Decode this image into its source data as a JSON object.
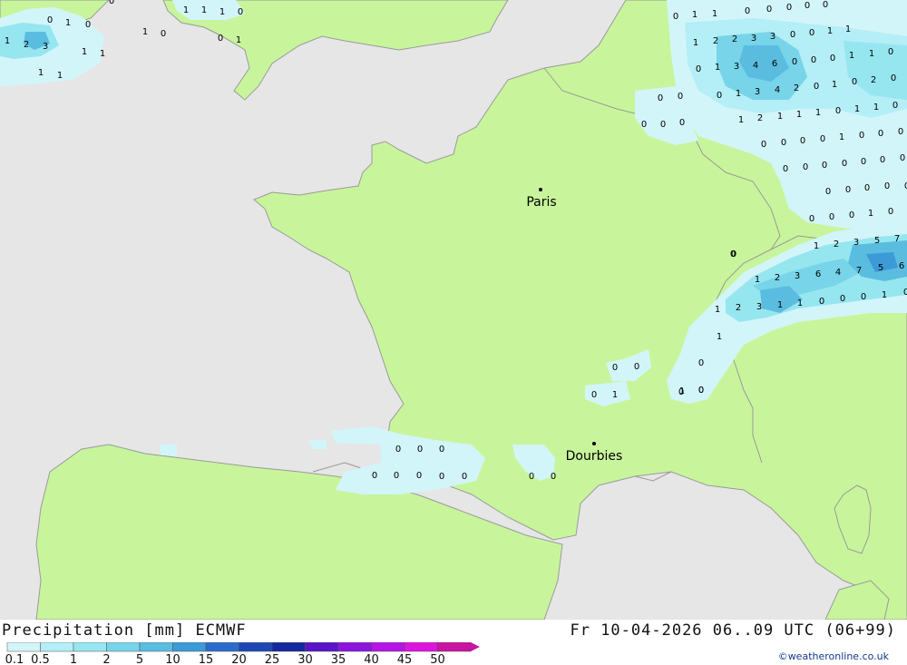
{
  "map": {
    "cities": [
      {
        "name": "Paris"
      },
      {
        "name": "Dourbies"
      }
    ],
    "precip_values_note": "Numbers are precipitation amounts (mm) printed on the map grid",
    "values": {
      "uk": [
        "0",
        "1",
        "0",
        "1",
        "1",
        "1",
        "0",
        "1",
        "0",
        "0",
        "1",
        "1",
        "2",
        "3",
        "1",
        "1",
        "1",
        "1",
        "0"
      ],
      "benelux": [
        "0",
        "1",
        "1",
        "0",
        "0",
        "0",
        "0",
        "0",
        "1",
        "2",
        "2",
        "3",
        "3",
        "0",
        "0",
        "1",
        "1",
        "0",
        "1",
        "3",
        "4",
        "6",
        "0",
        "0",
        "0",
        "1",
        "1",
        "0",
        "0",
        "1",
        "3",
        "4",
        "2",
        "0",
        "1",
        "0",
        "2",
        "0",
        "0",
        "0",
        "1",
        "2",
        "1",
        "1",
        "1",
        "0",
        "1",
        "1",
        "0",
        "0",
        "0",
        "0",
        "0",
        "0",
        "0",
        "0",
        "1",
        "0",
        "0",
        "0",
        "0",
        "0",
        "0",
        "0",
        "0",
        "0",
        "0",
        "0",
        "0",
        "0",
        "0",
        "0",
        "0",
        "0",
        "1",
        "0",
        "0",
        "0",
        "0"
      ],
      "alps": [
        "1",
        "2",
        "3",
        "5",
        "7",
        "1",
        "2",
        "3",
        "6",
        "4",
        "7",
        "5",
        "6",
        "1",
        "2",
        "3",
        "1",
        "1",
        "0",
        "0",
        "0",
        "1",
        "0",
        "0",
        "1",
        "0",
        "0"
      ],
      "central": [
        "0",
        "0",
        "0",
        "1",
        "1",
        "0"
      ],
      "southwest": [
        "0",
        "0",
        "0",
        "0",
        "0",
        "0",
        "0",
        "0",
        "0",
        "0"
      ]
    }
  },
  "footer": {
    "title": "Precipitation [mm] ECMWF",
    "datetime": "Fr 10-04-2026 06..09 UTC (06+99)",
    "credit": "©weatheronline.co.uk"
  },
  "legend": {
    "labels": [
      "0.1",
      "0.5",
      "1",
      "2",
      "5",
      "10",
      "15",
      "20",
      "25",
      "30",
      "35",
      "40",
      "45",
      "50"
    ],
    "colors": [
      "#d2f5fa",
      "#b4eef6",
      "#96e6f0",
      "#78d4e8",
      "#5abde0",
      "#3c9ad6",
      "#2a6ccc",
      "#1e46b4",
      "#1428a0",
      "#5a14c8",
      "#8c14dc",
      "#b414e6",
      "#dc14dc",
      "#c814a0"
    ]
  }
}
